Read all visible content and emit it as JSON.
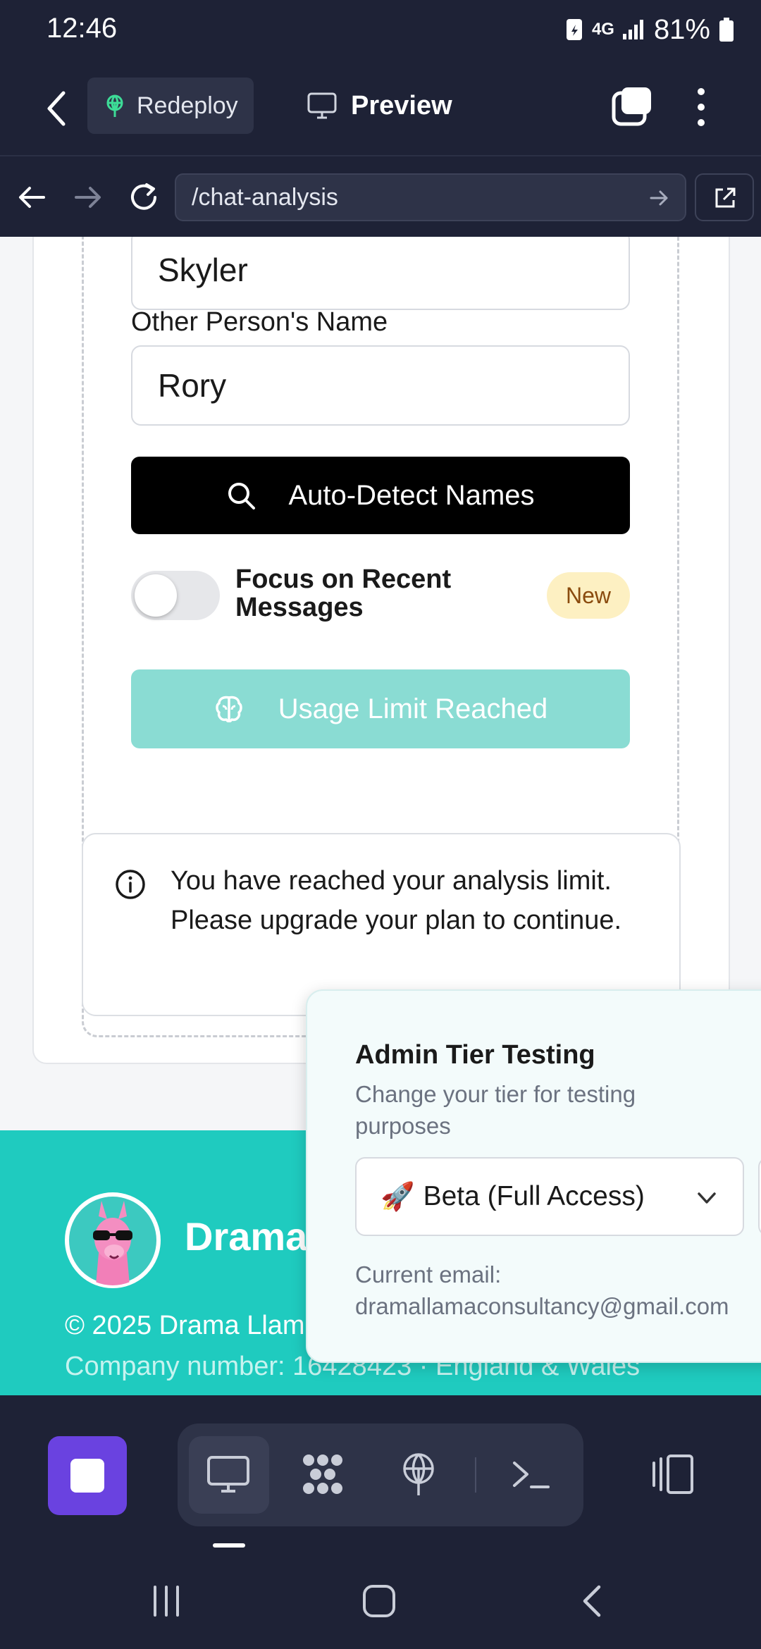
{
  "status_bar": {
    "time": "12:46",
    "network": "4G",
    "battery": "81%"
  },
  "app_header": {
    "redeploy_label": "Redeploy",
    "preview_label": "Preview"
  },
  "browser": {
    "url": "/chat-analysis"
  },
  "form": {
    "your_name_value": "Skyler",
    "other_name_label": "Other Person's Name",
    "other_name_value": "Rory",
    "auto_detect_label": "Auto-Detect Names",
    "toggle_label": "Focus on Recent Messages",
    "toggle_on": false,
    "new_badge": "New",
    "submit_label": "Usage Limit Reached"
  },
  "alert": {
    "message": "You have reached your analysis limit. Please upgrade your plan to continue."
  },
  "footer": {
    "brand": "Drama Llama",
    "copyright": "© 2025 Drama Llama",
    "company_number": "Company number: 16428423 · England & Wales"
  },
  "admin_popup": {
    "title": "Admin Tier Testing",
    "subtitle": "Change your tier for testing purposes",
    "tier_icon": "🚀",
    "tier_value": "Beta (Full Access)",
    "email_label": "Current email:",
    "email_value": "dramallamaconsultancy@gmail.com"
  },
  "colors": {
    "dark_bg": "#1e2236",
    "teal_button": "#8adcd3",
    "footer_teal": "#1fcbbf",
    "stop_purple": "#6a42e0",
    "badge_bg": "#fdf0c2"
  },
  "icons": [
    "back-icon",
    "antenna-icon",
    "monitor-icon",
    "tabs-icon",
    "more-icon",
    "search-icon",
    "brain-icon",
    "info-icon",
    "chevron-down-icon",
    "terminal-icon",
    "panel-icon"
  ]
}
